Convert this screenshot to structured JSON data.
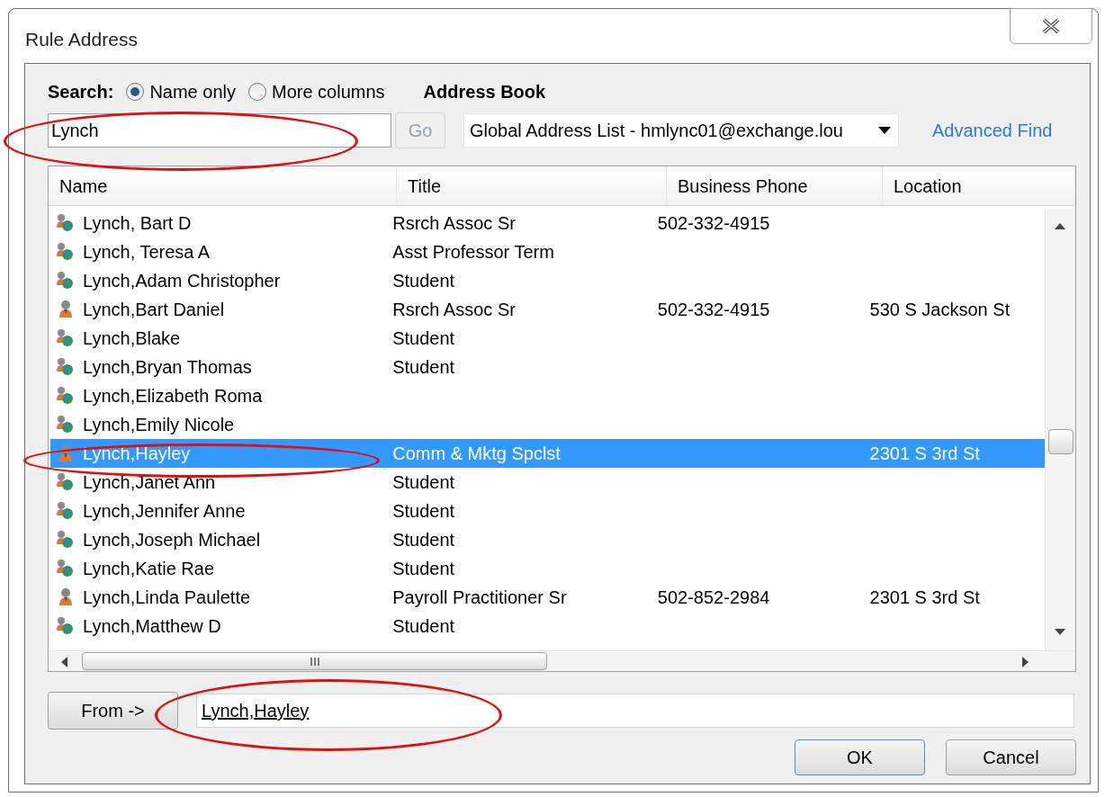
{
  "window": {
    "title": "Rule Address"
  },
  "search": {
    "label": "Search:",
    "options": [
      {
        "label": "Name only",
        "selected": true
      },
      {
        "label": "More columns",
        "selected": false
      }
    ],
    "value": "Lynch",
    "go_button": "Go",
    "go_disabled": true
  },
  "address_book": {
    "label": "Address Book",
    "value": "Global Address List - hmlync01@exchange.lou",
    "advanced_find": "Advanced Find"
  },
  "table": {
    "columns": [
      "Name",
      "Title",
      "Business Phone",
      "Location"
    ],
    "rows": [
      {
        "kind": "group",
        "name": "Lynch, Bart D",
        "title": "Rsrch Assoc Sr",
        "phone": "502-332-4915",
        "location": "",
        "selected": false
      },
      {
        "kind": "group",
        "name": "Lynch, Teresa A",
        "title": "Asst Professor Term",
        "phone": "",
        "location": "",
        "selected": false
      },
      {
        "kind": "group",
        "name": "Lynch,Adam Christopher",
        "title": "Student",
        "phone": "",
        "location": "",
        "selected": false
      },
      {
        "kind": "person",
        "name": "Lynch,Bart Daniel",
        "title": "Rsrch Assoc Sr",
        "phone": "502-332-4915",
        "location": "530 S Jackson St",
        "selected": false
      },
      {
        "kind": "group",
        "name": "Lynch,Blake",
        "title": "Student",
        "phone": "",
        "location": "",
        "selected": false
      },
      {
        "kind": "group",
        "name": "Lynch,Bryan Thomas",
        "title": "Student",
        "phone": "",
        "location": "",
        "selected": false
      },
      {
        "kind": "group",
        "name": "Lynch,Elizabeth Roma",
        "title": "",
        "phone": "",
        "location": "",
        "selected": false
      },
      {
        "kind": "group",
        "name": "Lynch,Emily Nicole",
        "title": "",
        "phone": "",
        "location": "",
        "selected": false
      },
      {
        "kind": "person",
        "name": "Lynch,Hayley",
        "title": "Comm & Mktg Spclst",
        "phone": "",
        "location": "2301 S 3rd St",
        "selected": true
      },
      {
        "kind": "group",
        "name": "Lynch,Janet Ann",
        "title": "Student",
        "phone": "",
        "location": "",
        "selected": false
      },
      {
        "kind": "group",
        "name": "Lynch,Jennifer Anne",
        "title": "Student",
        "phone": "",
        "location": "",
        "selected": false
      },
      {
        "kind": "group",
        "name": "Lynch,Joseph Michael",
        "title": "Student",
        "phone": "",
        "location": "",
        "selected": false
      },
      {
        "kind": "group",
        "name": "Lynch,Katie Rae",
        "title": "Student",
        "phone": "",
        "location": "",
        "selected": false
      },
      {
        "kind": "person",
        "name": "Lynch,Linda Paulette",
        "title": "Payroll Practitioner Sr",
        "phone": "502-852-2984",
        "location": "2301 S 3rd St",
        "selected": false
      },
      {
        "kind": "group",
        "name": "Lynch,Matthew D",
        "title": "Student",
        "phone": "",
        "location": "",
        "selected": false
      }
    ]
  },
  "from_button": "From ->",
  "from_value": "Lynch,Hayley",
  "buttons": [
    "OK",
    "Cancel"
  ]
}
